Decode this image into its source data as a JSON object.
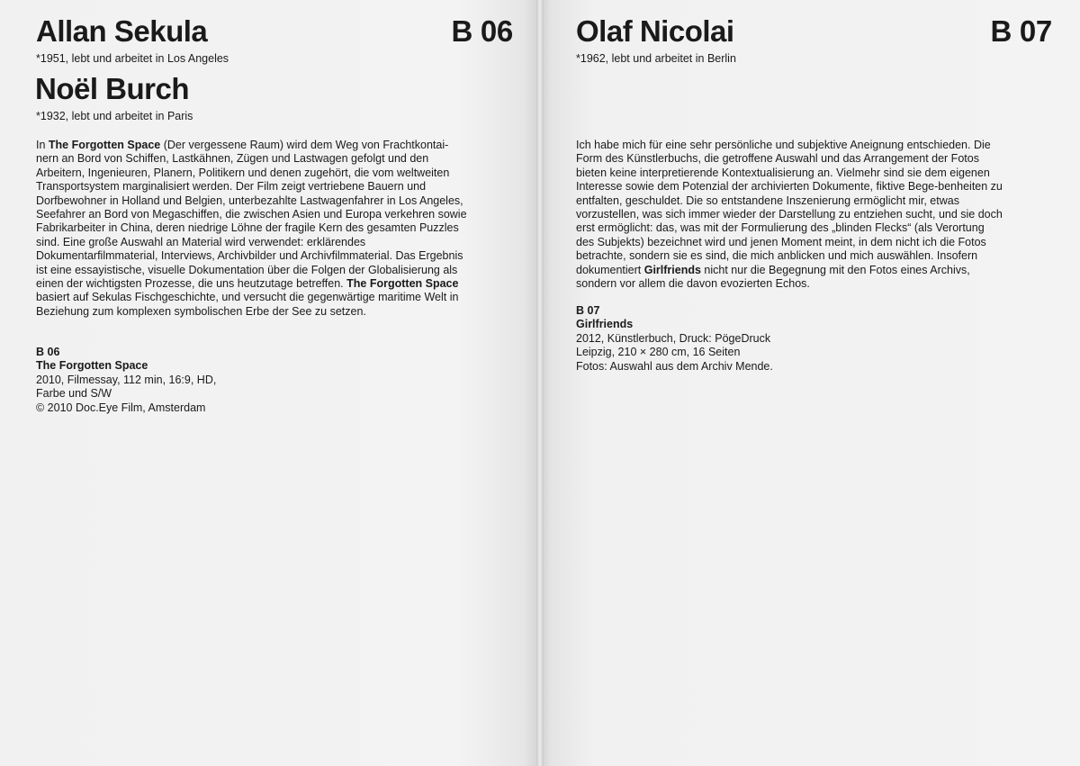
{
  "left_page": {
    "artist1": {
      "name": "Allan Sekula",
      "bio": "*1951, lebt und arbeitet in Los Angeles"
    },
    "artist2": {
      "name": "Noël Burch",
      "bio": "*1932, lebt und arbeitet in Paris"
    },
    "code": "B 06",
    "body": {
      "intro": "In ",
      "title1": "The Forgotten Space",
      "part1": " (Der vergessene Raum) wird dem Weg von Frachtkontai-nern an Bord von Schiffen, Lastkähnen, Zügen und Lastwagen gefolgt und den Arbeitern, Ingenieuren, Planern, Politikern und denen zugehört, die vom weltweiten Transportsystem marginalisiert werden. Der Film zeigt vertriebene Bauern und Dorfbewohner in Holland und Belgien, unterbezahlte Lastwagenfahrer in Los Angeles, Seefahrer an Bord von Megaschiffen, die zwischen Asien und Europa verkehren sowie Fabrikarbeiter in China, deren niedrige Löhne der fragile Kern des gesamten Puzzles sind. Eine große Auswahl an Material wird verwendet: erklärendes Dokumentarfilmmaterial, Interviews, Archivbilder und Archivfilmmaterial. Das Ergebnis ist eine essayistische, visuelle Dokumentation über die Folgen der Globalisierung als einen der wichtigsten Prozesse, die uns heutzutage betreffen. ",
      "title2": "The Forgotten Space",
      "part2": " basiert auf Sekulas Fischgeschichte, und versucht die gegenwärtige maritime Welt in Beziehung zum komplexen symbolischen Erbe der See zu setzen."
    },
    "meta": {
      "code": "B 06",
      "title": "The Forgotten Space",
      "line1": "2010, Filmessay, 112 min, 16:9, HD,",
      "line2": "Farbe und S/W",
      "line3": "© 2010 Doc.Eye Film, Amsterdam"
    }
  },
  "right_page": {
    "artist": {
      "name": "Olaf Nicolai",
      "bio": "*1962, lebt und arbeitet in Berlin"
    },
    "code": "B 07",
    "body": {
      "part1": "Ich habe mich für eine sehr persönliche und subjektive Aneignung entschieden. Die Form des Künstlerbuchs, die getroffene Auswahl und das Arrangement der Fotos bieten keine interpretierende Kontextualisierung an. Vielmehr sind sie dem eigenen Interesse sowie dem Potenzial der archivierten Dokumente, fiktive Bege-benheiten zu entfalten, geschuldet. Die so entstandene Inszenierung ermöglicht mir, etwas vorzustellen, was sich immer wieder der Darstellung zu entziehen sucht, und sie doch erst ermöglicht: das, was mit der Formulierung des „blinden Flecks“ (als Verortung des Subjekts) bezeichnet wird und jenen Moment meint, in dem nicht ich die Fotos betrachte, sondern sie es sind, die mich anblicken und mich auswählen. Insofern dokumentiert ",
      "title": "Girlfriends",
      "part2": " nicht nur die Begegnung mit den Fotos eines Archivs, sondern vor allem die davon evozierten Echos."
    },
    "meta": {
      "code": "B 07",
      "title": "Girlfriends",
      "line1": "2012, Künstlerbuch, Druck: PögeDruck",
      "line2": "Leipzig, 210 × 280 cm, 16 Seiten",
      "line3": "Fotos: Auswahl aus dem Archiv Mende."
    }
  }
}
